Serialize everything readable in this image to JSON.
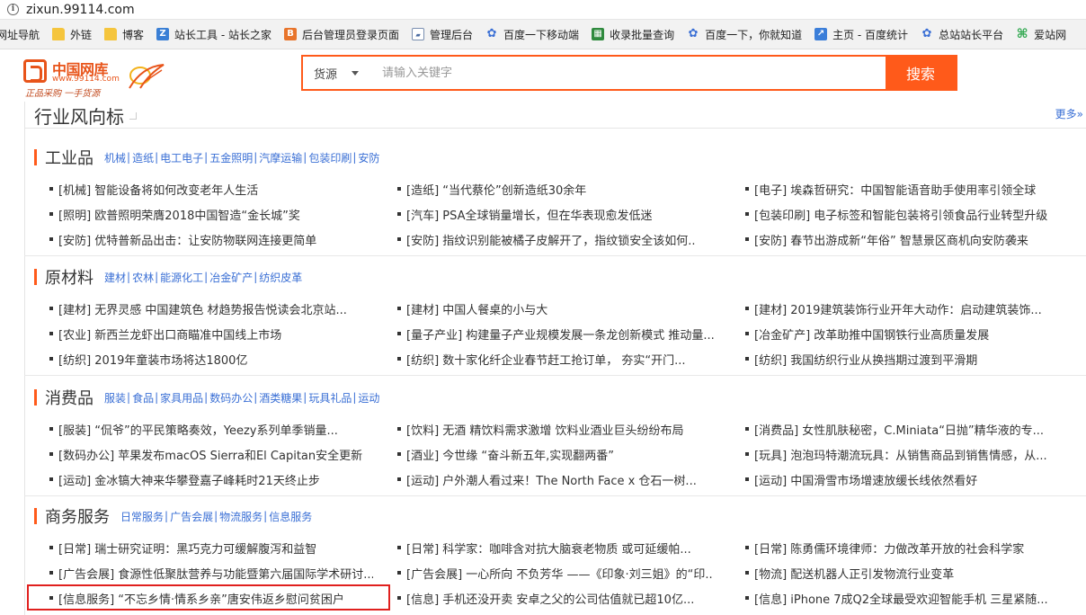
{
  "browser": {
    "url": "zixun.99114.com",
    "bookmarks": [
      {
        "label": "网址导航",
        "icon": "none"
      },
      {
        "label": "外链",
        "icon": "folder-icon"
      },
      {
        "label": "博客",
        "icon": "folder-icon"
      },
      {
        "label": "站长工具 - 站长之家",
        "icon": "chinaz-icon"
      },
      {
        "label": "后台管理员登录页面",
        "icon": "b-icon"
      },
      {
        "label": "管理后台",
        "icon": "admin-icon"
      },
      {
        "label": "百度一下移动端",
        "icon": "baidu-paw-icon"
      },
      {
        "label": "收录批量查询",
        "icon": "grid-icon"
      },
      {
        "label": "百度一下，你就知道",
        "icon": "baidu-paw-icon"
      },
      {
        "label": "主页 - 百度统计",
        "icon": "chart-icon"
      },
      {
        "label": "总站站长平台",
        "icon": "baidu-paw-icon"
      },
      {
        "label": "爱站网",
        "icon": "aizhan-icon"
      }
    ]
  },
  "header": {
    "logo": {
      "name": "中国网库",
      "url": "www.99114.com",
      "slogan": "正品采购 一手货源"
    },
    "search": {
      "category": "货源",
      "placeholder": "请输入关键字",
      "button": "搜索"
    }
  },
  "panel": {
    "title": "行业风向标",
    "more": "更多»"
  },
  "sections": [
    {
      "name": "工业品",
      "categories": [
        "机械",
        "造纸",
        "电工电子",
        "五金照明",
        "汽摩运输",
        "包装印刷",
        "安防"
      ],
      "rows": [
        [
          "[机械] 智能设备将如何改变老年人生活",
          "[造纸] “当代蔡伦”创新造纸30余年",
          "[电子] 埃森哲研究：中国智能语音助手使用率引领全球"
        ],
        [
          "[照明] 欧普照明荣膺2018中国智造“金长城”奖",
          "[汽车] PSA全球销量增长，但在华表现愈发低迷",
          "[包装印刷] 电子标签和智能包装将引领食品行业转型升级"
        ],
        [
          "[安防] 优特普新品出击：让安防物联网连接更简单",
          "[安防] 指纹识别能被橘子皮解开了，指纹锁安全该如何..",
          "[安防] 春节出游成新“年俗” 智慧景区商机向安防袭来"
        ]
      ]
    },
    {
      "name": "原材料",
      "categories": [
        "建材",
        "农林",
        "能源化工",
        "冶金矿产",
        "纺织皮革"
      ],
      "rows": [
        [
          "[建材] 无界灵感 中国建筑色 材趋势报告悦读会北京站...",
          "[建材] 中国人餐桌的小与大",
          "[建材] 2019建筑装饰行业开年大动作：启动建筑装饰..."
        ],
        [
          "[农业] 新西兰龙虾出口商瞄准中国线上市场",
          "[量子产业] 构建量子产业规模发展一条龙创新模式 推动量...",
          "[冶金矿产] 改革助推中国钢铁行业高质量发展"
        ],
        [
          "[纺织] 2019年童装市场将达1800亿",
          "[纺织] 数十家化纤企业春节赶工抢订单， 夯实“开门...",
          "[纺织] 我国纺织行业从换挡期过渡到平滑期"
        ]
      ]
    },
    {
      "name": "消费品",
      "categories": [
        "服装",
        "食品",
        "家具用品",
        "数码办公",
        "酒类糖果",
        "玩具礼品",
        "运动"
      ],
      "rows": [
        [
          "[服装] “侃爷”的平民策略奏效，Yeezy系列单季销量...",
          "[饮料] 无酒 精饮料需求激增 饮料业酒业巨头纷纷布局",
          "[消费品] 女性肌肤秘密，C.Miniata“日抛”精华液的专..."
        ],
        [
          "[数码办公] 苹果发布macOS Sierra和El Capitan安全更新",
          "[酒业] 今世缘 “奋斗新五年,实现翻两番”",
          "[玩具] 泡泡玛特潮流玩具：从销售商品到销售情感，从..."
        ],
        [
          "[运动] 金冰镐大神来华攀登嘉子峰耗时21天终止步",
          "[运动] 户外潮人看过来！The North Face x 仓石一树...",
          "[运动] 中国滑雪市场增速放缓长线依然看好"
        ]
      ]
    },
    {
      "name": "商务服务",
      "categories": [
        "日常服务",
        "广告会展",
        "物流服务",
        "信息服务"
      ],
      "rows": [
        [
          "[日常] 瑞士研究证明：黑巧克力可缓解腹泻和益智",
          "[日常] 科学家：咖啡含对抗大脑衰老物质 或可延缓帕...",
          "[日常] 陈勇儒环境律师：力做改革开放的社会科学家"
        ],
        [
          "[广告会展] 食源性低聚肽营养与功能暨第六届国际学术研讨...",
          "[广告会展] 一心所向 不负芳华 ——《印象·刘三姐》的“印...",
          "[物流] 配送机器人正引发物流行业变革"
        ],
        [
          "[信息服务] “不忘乡情·情系乡亲”唐安伟返乡慰问贫困户",
          "[信息] 手机还没开卖 安卓之父的公司估值就已超10亿...",
          "[信息] iPhone 7成Q2全球最受欢迎智能手机 三星紧随..."
        ]
      ]
    }
  ]
}
